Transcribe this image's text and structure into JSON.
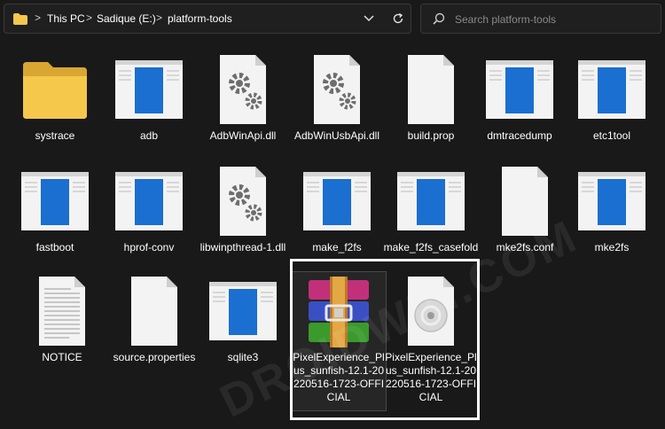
{
  "breadcrumb": {
    "items": [
      "This PC",
      "Sadique (E:)",
      "platform-tools"
    ],
    "separator": ">",
    "expand_glyph": ">"
  },
  "search": {
    "placeholder": "Search platform-tools"
  },
  "files": [
    {
      "name": "systrace",
      "icon": "folder-icon"
    },
    {
      "name": "adb",
      "icon": "exe-window-icon"
    },
    {
      "name": "AdbWinApi.dll",
      "icon": "gears-file-icon"
    },
    {
      "name": "AdbWinUsbApi.dll",
      "icon": "gears-file-icon"
    },
    {
      "name": "build.prop",
      "icon": "blank-file-icon"
    },
    {
      "name": "dmtracedump",
      "icon": "exe-window-icon"
    },
    {
      "name": "etc1tool",
      "icon": "exe-window-icon"
    },
    {
      "name": "fastboot",
      "icon": "exe-window-icon"
    },
    {
      "name": "hprof-conv",
      "icon": "exe-window-icon"
    },
    {
      "name": "libwinpthread-1.dll",
      "icon": "gears-file-icon"
    },
    {
      "name": "make_f2fs",
      "icon": "exe-window-icon"
    },
    {
      "name": "make_f2fs_casefold",
      "icon": "exe-window-icon"
    },
    {
      "name": "mke2fs.conf",
      "icon": "blank-file-icon"
    },
    {
      "name": "mke2fs",
      "icon": "exe-window-icon"
    },
    {
      "name": "NOTICE",
      "icon": "text-file-icon"
    },
    {
      "name": "source.properties",
      "icon": "blank-file-icon"
    },
    {
      "name": "sqlite3",
      "icon": "exe-window-icon"
    },
    {
      "name": "PixelExperience_Plus_sunfish-12.1-20220516-1723-OFFICIAL",
      "icon": "winrar-archive-icon"
    },
    {
      "name": "PixelExperience_Plus_sunfish-12.1-20220516-1723-OFFICIAL",
      "icon": "disc-image-icon"
    }
  ],
  "watermark": "DROIDWIN.COM",
  "colors": {
    "background": "#191919",
    "folder": "#f5c84c",
    "exe_blue": "#1a6fd0",
    "highlight": "#ffffff"
  }
}
